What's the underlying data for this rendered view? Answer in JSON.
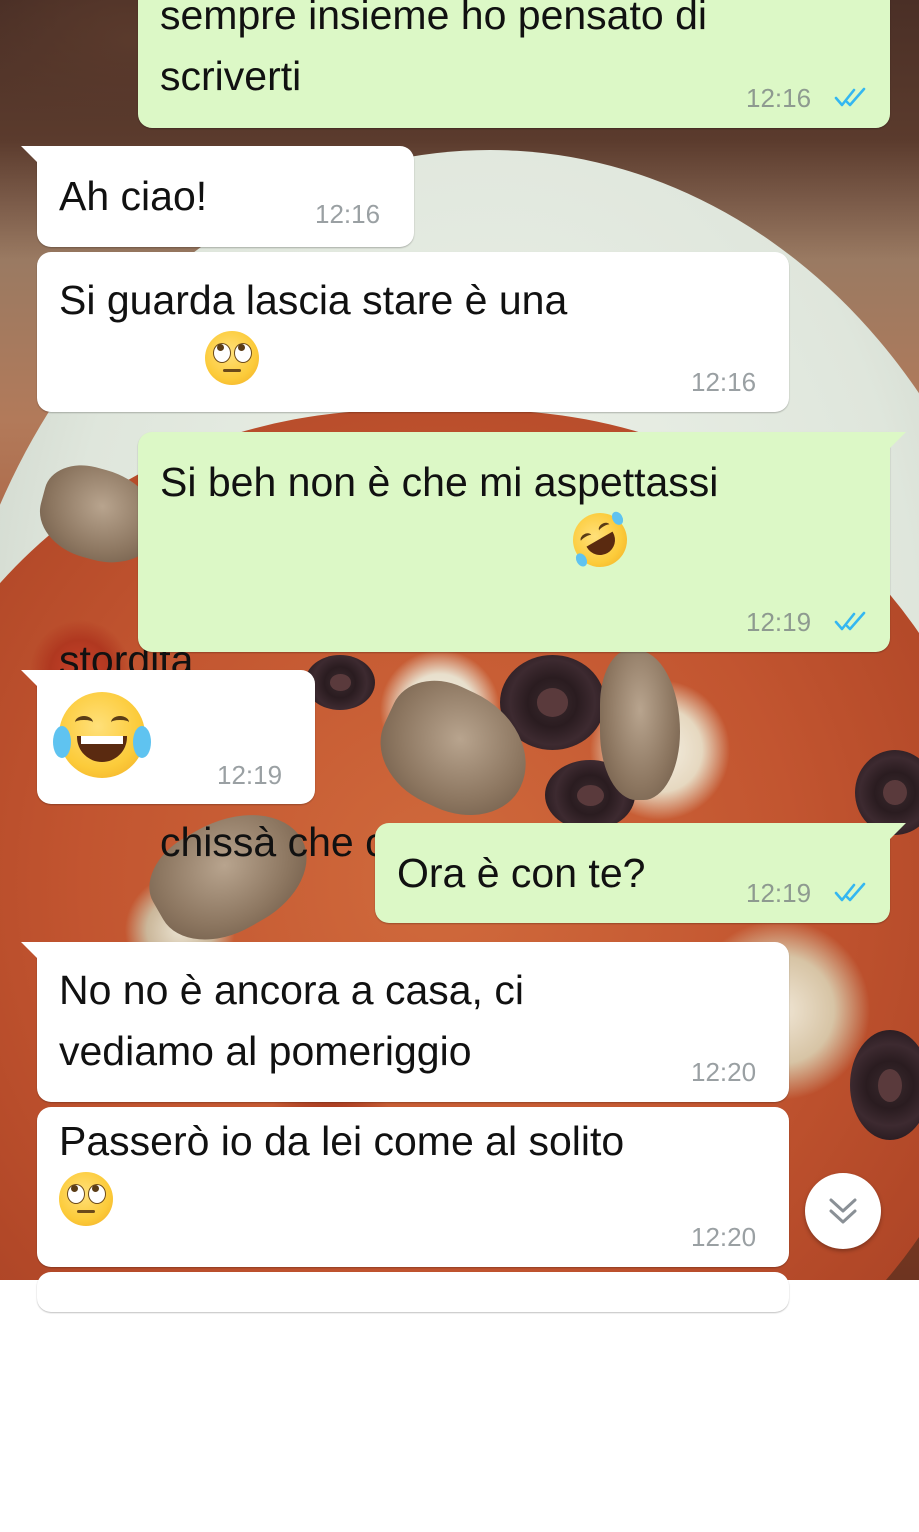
{
  "messages": [
    {
      "direction": "out",
      "text": "sempre insieme ho pensato di\nscriverti",
      "time": "12:16",
      "status": "read"
    },
    {
      "direction": "in",
      "text": "Ah ciao!",
      "time": "12:16"
    },
    {
      "direction": "in",
      "text": "Si guarda lascia stare è una\nstordita",
      "emoji": "face-with-rolling-eyes",
      "time": "12:16"
    },
    {
      "direction": "out",
      "text": "Si beh non è che mi aspettassi\nchissà che cosa da lei",
      "emoji": "rolling-on-the-floor-laughing",
      "time": "12:19",
      "status": "read"
    },
    {
      "direction": "in",
      "text": "",
      "emoji": "face-with-tears-of-joy",
      "time": "12:19"
    },
    {
      "direction": "out",
      "text": "Ora è con te?",
      "time": "12:19",
      "status": "read"
    },
    {
      "direction": "in",
      "text": "No no è ancora a casa, ci\nvediamo al pomeriggio",
      "time": "12:20"
    },
    {
      "direction": "in",
      "text": "Passerò io da lei come al solito",
      "emoji": "face-with-rolling-eyes",
      "time": "12:20"
    }
  ],
  "scroll_button": {
    "icon": "double-chevron-down-icon"
  },
  "colors": {
    "incoming_bubble": "#ffffff",
    "outgoing_bubble": "#dcf8c6",
    "read_ticks": "#34b7f1",
    "timestamp": "#8e9a90"
  }
}
